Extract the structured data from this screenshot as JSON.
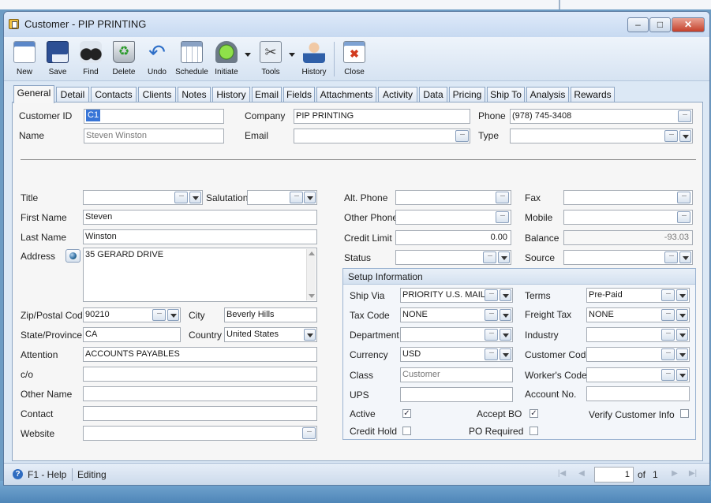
{
  "window": {
    "title": "Customer - PIP PRINTING",
    "min": "–",
    "max": "□",
    "close": "✕"
  },
  "toolbar": [
    {
      "label": "New",
      "icon": "new-icon"
    },
    {
      "label": "Save",
      "icon": "save-icon"
    },
    {
      "label": "Find",
      "icon": "find-icon"
    },
    {
      "label": "Delete",
      "icon": "delete-icon"
    },
    {
      "label": "Undo",
      "icon": "undo-icon"
    },
    {
      "label": "Schedule",
      "icon": "schedule-icon"
    },
    {
      "label": "Initiate",
      "icon": "initiate-icon"
    },
    {
      "label": "Tools",
      "icon": "tools-icon"
    },
    {
      "label": "History",
      "icon": "history-icon"
    },
    {
      "label": "Close",
      "icon": "close-icon"
    }
  ],
  "tabs": [
    "General",
    "Detail",
    "Contacts",
    "Clients",
    "Notes",
    "History",
    "Email",
    "Fields",
    "Attachments",
    "Activity",
    "Data",
    "Pricing",
    "Ship To",
    "Analysis",
    "Rewards"
  ],
  "header": {
    "customer_id_label": "Customer ID",
    "customer_id": "C1",
    "name_label": "Name",
    "name": "Steven Winston",
    "company_label": "Company",
    "company": "PIP PRINTING",
    "email_label": "Email",
    "email": "",
    "phone_label": "Phone",
    "phone": "(978) 745-3408",
    "type_label": "Type",
    "type": ""
  },
  "left": {
    "title_label": "Title",
    "title": "",
    "salutation_label": "Salutation",
    "salutation": "",
    "first_name_label": "First Name",
    "first_name": "Steven",
    "last_name_label": "Last Name",
    "last_name": "Winston",
    "address_label": "Address",
    "address": "35 GERARD DRIVE",
    "zip_label": "Zip/Postal Code",
    "zip": "90210",
    "city_label": "City",
    "city": "Beverly Hills",
    "state_label": "State/Province",
    "state": "CA",
    "country_label": "Country",
    "country": "United States",
    "attention_label": "Attention",
    "attention": "ACCOUNTS PAYABLES",
    "co_label": "c/o",
    "co": "",
    "other_name_label": "Other Name",
    "other_name": "",
    "contact_label": "Contact",
    "contact": "",
    "website_label": "Website",
    "website": ""
  },
  "middle": {
    "alt_phone_label": "Alt. Phone",
    "alt_phone": "",
    "other_phone_label": "Other Phone",
    "other_phone": "",
    "credit_limit_label": "Credit Limit",
    "credit_limit": "0.00",
    "status_label": "Status",
    "status": ""
  },
  "right": {
    "fax_label": "Fax",
    "fax": "",
    "mobile_label": "Mobile",
    "mobile": "",
    "balance_label": "Balance",
    "balance": "-93.03",
    "source_label": "Source",
    "source": ""
  },
  "setup": {
    "heading": "Setup Information",
    "ship_via_label": "Ship Via",
    "ship_via": "PRIORITY U.S. MAIL",
    "tax_code_label": "Tax Code",
    "tax_code": "NONE",
    "department_label": "Department",
    "department": "",
    "currency_label": "Currency",
    "currency": "USD",
    "class_label": "Class",
    "class_placeholder": "Customer",
    "ups_label": "UPS",
    "ups": "",
    "terms_label": "Terms",
    "terms": "Pre-Paid",
    "freight_tax_label": "Freight Tax",
    "freight_tax": "NONE",
    "industry_label": "Industry",
    "industry": "",
    "customer_code_label": "Customer Code",
    "customer_code": "",
    "workers_code_label": "Worker's Code",
    "workers_code": "",
    "account_no_label": "Account No.",
    "account_no": "",
    "active_label": "Active",
    "active": true,
    "accept_bo_label": "Accept BO",
    "accept_bo": true,
    "verify_label": "Verify Customer Info",
    "verify": false,
    "credit_hold_label": "Credit Hold",
    "credit_hold": false,
    "po_required_label": "PO Required",
    "po_required": false
  },
  "statusbar": {
    "help": "F1 - Help",
    "mode": "Editing",
    "page": "1",
    "of_label": "of",
    "total": "1"
  }
}
